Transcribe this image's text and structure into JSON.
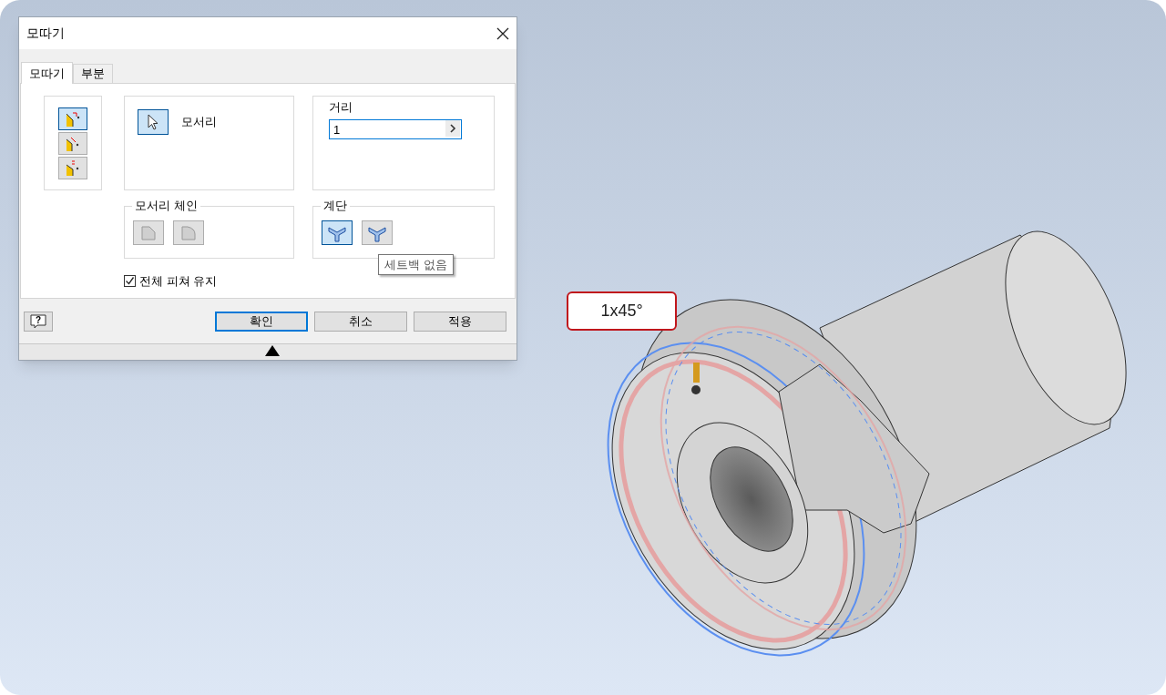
{
  "dialog": {
    "title": "모따기",
    "tabs": [
      {
        "label": "모따기",
        "selected": true
      },
      {
        "label": "부분",
        "selected": false
      }
    ],
    "methods": [
      {
        "selected": true
      },
      {
        "selected": false
      },
      {
        "selected": false
      }
    ],
    "edges": {
      "label": "모서리",
      "selected": true
    },
    "distance": {
      "label": "거리",
      "value": "1"
    },
    "edge_chain": {
      "label": "모서리 체인",
      "buttons": [
        {
          "selected": false
        },
        {
          "selected": false
        }
      ]
    },
    "setback": {
      "label": "계단",
      "buttons": [
        {
          "selected": true
        },
        {
          "selected": false
        }
      ]
    },
    "tooltip": "세트백 없음",
    "preserve_features": {
      "label": "전체 피쳐 유지",
      "checked": true
    },
    "buttons": [
      {
        "label": "확인",
        "selected": true
      },
      {
        "label": "취소",
        "selected": false
      },
      {
        "label": "적용",
        "selected": false
      }
    ]
  },
  "help_glyph": "?",
  "dimension_label": "1x45°"
}
